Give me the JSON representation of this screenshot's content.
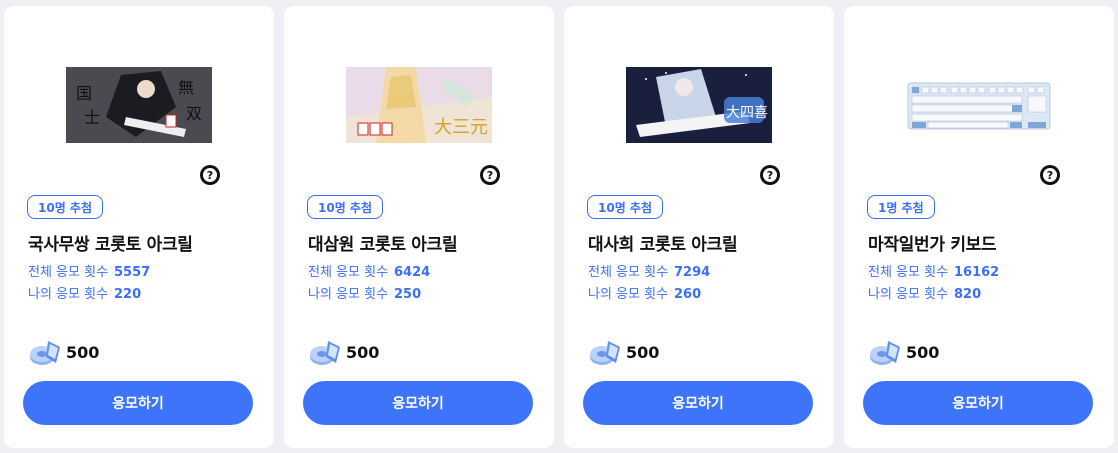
{
  "cards": [
    {
      "badge": "10명 추첨",
      "title": "국사무쌍 코롯토 아크릴",
      "total_label": "전체 응모 횟수",
      "total_value": "5557",
      "mine_label": "나의 응모 횟수",
      "mine_value": "220",
      "cost": "500",
      "button": "응모하기",
      "image_icon": "acrylic-artwork-dark"
    },
    {
      "badge": "10명 추첨",
      "title": "대삼원 코롯토 아크릴",
      "total_label": "전체 응모 횟수",
      "total_value": "6424",
      "mine_label": "나의 응모 횟수",
      "mine_value": "250",
      "cost": "500",
      "button": "응모하기",
      "image_icon": "acrylic-artwork-light"
    },
    {
      "badge": "10명 추첨",
      "title": "대사희 코롯토 아크릴",
      "total_label": "전체 응모 횟수",
      "total_value": "7294",
      "mine_label": "나의 응모 횟수",
      "mine_value": "260",
      "cost": "500",
      "button": "응모하기",
      "image_icon": "acrylic-artwork-night"
    },
    {
      "badge": "1명 추첨",
      "title": "마작일번가 키보드",
      "total_label": "전체 응모 횟수",
      "total_value": "16162",
      "mine_label": "나의 응모 횟수",
      "mine_value": "820",
      "cost": "500",
      "button": "응모하기",
      "image_icon": "keyboard"
    }
  ],
  "colors": {
    "accent": "#3d74fa",
    "stat_text": "#3d6ff5",
    "background": "#eff0f3"
  },
  "icons": {
    "help": "question-circle-icon",
    "currency": "coin-ticket-icon"
  }
}
